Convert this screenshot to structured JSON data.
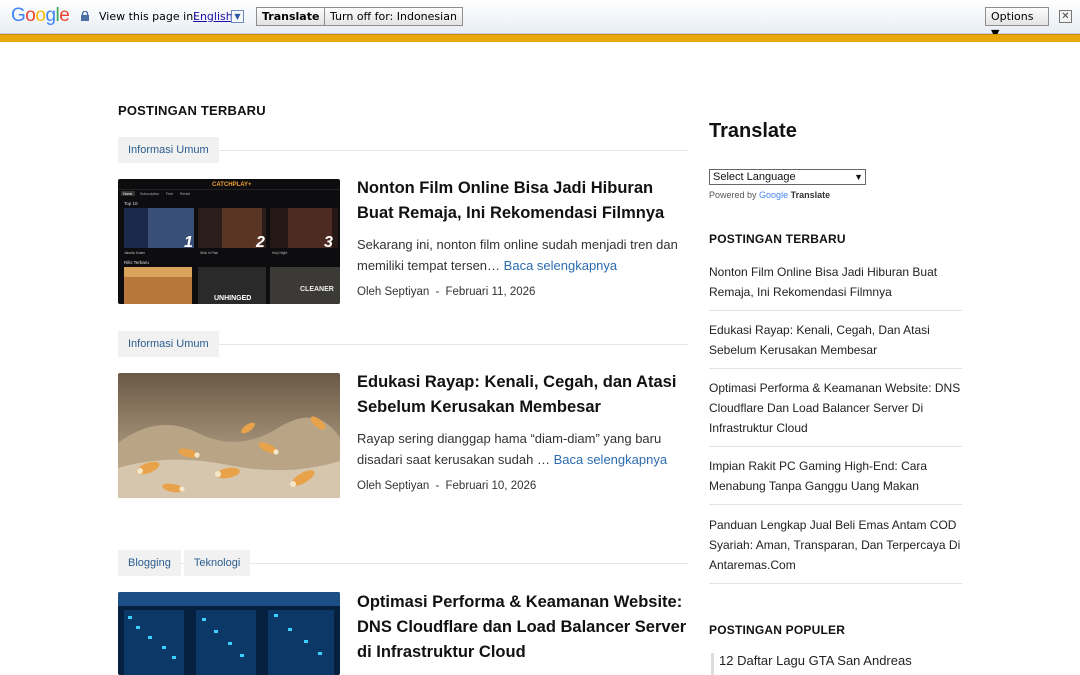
{
  "translate_bar": {
    "logo": [
      "G",
      "o",
      "o",
      "g",
      "l",
      "e"
    ],
    "prompt": "View this page in:",
    "language": "English",
    "dropdown_glyph": "▼",
    "translate_button": "Translate",
    "turn_off_button": "Turn off for: Indonesian",
    "options_button": "Options ▼",
    "close_glyph": "✕",
    "accent_color": "#e8a80c"
  },
  "main": {
    "section_title": "POSTINGAN TERBARU",
    "posts": [
      {
        "tags": [
          "Informasi Umum"
        ],
        "title": "Nonton Film Online Bisa Jadi Hiburan Buat Remaja, Ini Rekomendasi Filmnya",
        "excerpt": "Sekarang ini, nonton film online sudah menjadi tren dan memiliki tempat tersen…",
        "read_more": "Baca selengkapnya",
        "author": "Oleh Septiyan",
        "separator": "-",
        "date": "Februari 11, 2026",
        "thumb": {
          "brand": "CATCHPLAY+",
          "section1": "Top 10",
          "section2": "Rilis Terbaru",
          "captions": [
            "Jakarta Kolam",
            "Wick in Pain",
            "Holy Night"
          ],
          "ranks": [
            "1",
            "2",
            "3"
          ],
          "poster_title": "UNHINGED",
          "cleaner": "CLEANER",
          "nav": [
            "Home",
            "Subscription",
            "Free",
            "Rental"
          ]
        }
      },
      {
        "tags": [
          "Informasi Umum"
        ],
        "title": "Edukasi Rayap: Kenali, Cegah, dan Atasi Sebelum Kerusakan Membesar",
        "excerpt": "Rayap sering dianggap hama “diam-diam” yang baru disadari saat kerusakan sudah …",
        "read_more": "Baca selengkapnya",
        "author": "Oleh Septiyan",
        "separator": "-",
        "date": "Februari 10, 2026"
      },
      {
        "tags": [
          "Blogging",
          "Teknologi"
        ],
        "title": "Optimasi Performa & Keamanan Website: DNS Cloudflare dan Load Balancer Server di Infrastruktur Cloud"
      }
    ]
  },
  "sidebar": {
    "translate_heading": "Translate",
    "select_label": "Select Language",
    "powered_by": "Powered by",
    "google": "Google",
    "translate_word": "Translate",
    "recent_title": "POSTINGAN TERBARU",
    "recent": [
      "Nonton Film Online Bisa Jadi Hiburan Buat Remaja, Ini Rekomendasi Filmnya",
      "Edukasi Rayap: Kenali, Cegah, Dan Atasi Sebelum Kerusakan Membesar",
      "Optimasi Performa & Keamanan Website: DNS Cloudflare Dan Load Balancer Server Di Infrastruktur Cloud",
      "Impian Rakit PC Gaming High-End: Cara Menabung Tanpa Ganggu Uang Makan",
      "Panduan Lengkap Jual Beli Emas Antam COD Syariah: Aman, Transparan, Dan Terpercaya Di Antaremas.Com"
    ],
    "popular_title": "POSTINGAN POPULER",
    "popular": [
      "12 Daftar Lagu GTA San Andreas"
    ]
  },
  "colors": {
    "link": "#2b6cb0",
    "tag_text": "#2b5d8f",
    "tag_bg": "#f1f1f1"
  }
}
